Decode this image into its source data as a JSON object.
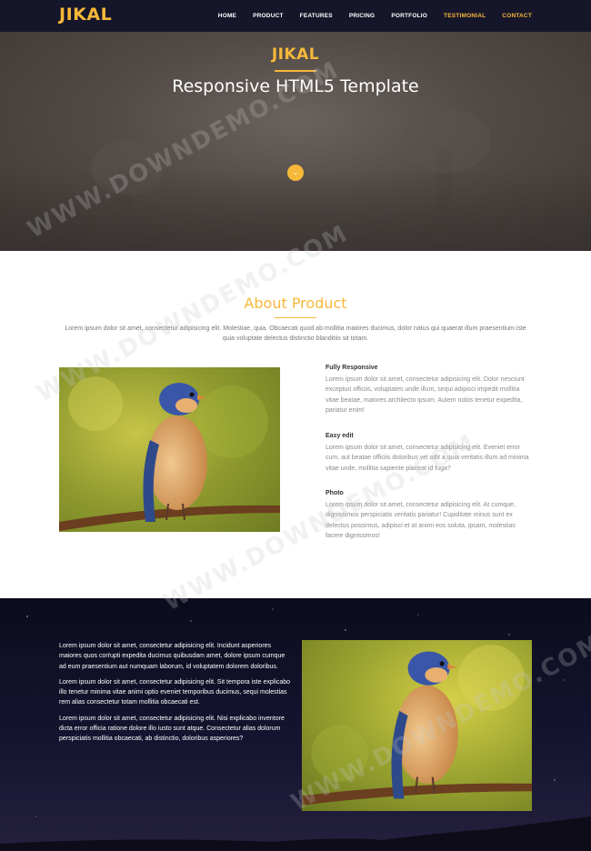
{
  "nav": {
    "logo": "JIKAL",
    "items": [
      {
        "label": "HOME",
        "active": false
      },
      {
        "label": "PRODUCT",
        "active": false
      },
      {
        "label": "FEATURES",
        "active": false
      },
      {
        "label": "PRICING",
        "active": false
      },
      {
        "label": "PORTFOLIO",
        "active": false
      },
      {
        "label": "TESTIMONIAL",
        "active": true
      },
      {
        "label": "CONTACT",
        "active": true
      }
    ]
  },
  "hero": {
    "title": "JIKAL",
    "subtitle": "Responsive HTML5 Template",
    "button_icon": "chevron-down-icon"
  },
  "about": {
    "title": "About Product",
    "description": "Lorem ipsum dolor sit amet, consectetur adipisicing elit. Molestiae, quia. Obcaecati quod ab mollitia maiores ducimus, dolor natus qui quaerat illum praesentium iste quia voluptate delectus distinctio blanditiis sit totam.",
    "features": [
      {
        "title": "Fully Responsive",
        "text": "Lorem ipsum dolor sit amet, consectetur adipisicing elit. Dolor nesciunt excepturi officiis, voluptates unde illum, sequi adipisci impedit mollitia vitae beatae, maiores architecto ipsum. Autem nobis tenetur expedita, pariatur enim!"
      },
      {
        "title": "Easy edit",
        "text": "Lorem ipsum dolor sit amet, consectetur adipisicing elit. Eveniet error cum, aut beatae officiis doloribus vel odit a quia veritatis illum ad minima vitae unde, mollitia sapiente placeat id fuga?"
      },
      {
        "title": "Photo",
        "text": "Lorem ipsum dolor sit amet, consectetur adipisicing elit. At cumque, dignissimos perspiciatis veritatis pariatur! Cupiditate minus sunt ex delectus possimus, adipisci et at animi eos soluta, ipsam, molestias facere dignissimos!"
      }
    ]
  },
  "dark_section": {
    "paragraphs": [
      "Lorem ipsum dolor sit amet, consectetur adipisicing elit. Incidunt asperiores maiores quos corrupti expedita ducimus quibusdam amet, dolore ipsum cumque ad eum praesentium aut numquam laborum, id voluptatem dolorem doloribus.",
      "Lorem ipsum dolor sit amet, consectetur adipisicing elit. Sit tempora iste explicabo illo tenetur minima vitae animi optio eveniet temporibus ducimus, sequi molestias rem alias consectetur totam mollitia obcaecati est.",
      "Lorem ipsum dolor sit amet, consectetur adipisicing elit. Nisi explicabo inventore dicta error officia ratione dolore illo iusto sunt atque. Consectetur alias dolorum perspiciatis mollitia obcaecati, ab distinctio, doloribus asperiores?"
    ]
  },
  "watermark": "WWW.DOWNDEMO.COM",
  "colors": {
    "accent": "#f6b83a",
    "nav_bg": "#16162a",
    "hero_bg": "#524a46",
    "dark_bg": "#141430"
  }
}
